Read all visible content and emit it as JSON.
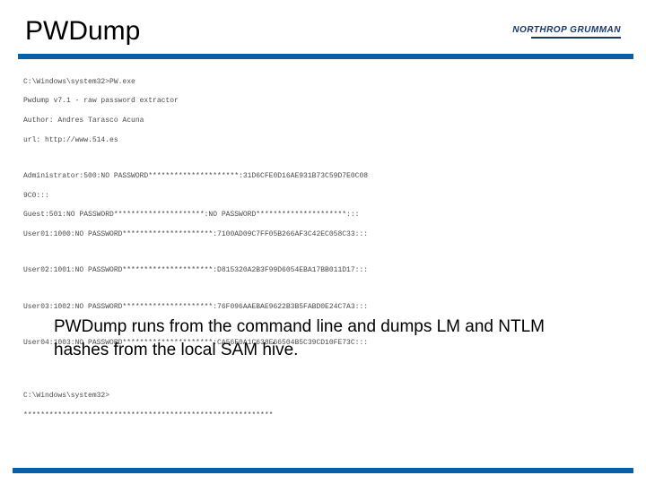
{
  "header": {
    "title": "PWDump",
    "logo_text": "NORTHROP GRUMMAN"
  },
  "console": {
    "l1": "C:\\Windows\\system32>PW.exe",
    "l2": "Pwdump v7.1 - raw password extractor",
    "l3": "Author: Andres Tarasco Acuna",
    "l4": "url: http://www.514.es",
    "l5": "Administrator:500:NO PASSWORD*********************:31D6CFE0D16AE931B73C59D7E0C08",
    "l6": "9C0:::",
    "l7": "Guest:501:NO PASSWORD*********************:NO PASSWORD*********************:::",
    "l8": "User01:1000:NO PASSWORD*********************:7100AD09C7FF05B266AF3C42EC058C33:::",
    "l9": "User02:1001:NO PASSWORD*********************:D815320A2B3F99D6054EBA17BB011D17:::",
    "l10": "User03:1002:NO PASSWORD*********************:76F096AAEBAE9622B3B5FABD0E24C7A3:::",
    "l11": "User04:1003:NO PASSWORD*********************:CA56F0A1C638E66504B5C39CD10FE73C:::",
    "l12": "C:\\Windows\\system32>",
    "l13": "**********************************************************"
  },
  "description": "PWDump runs from the command line and dumps LM and NTLM hashes from the local SAM hive."
}
